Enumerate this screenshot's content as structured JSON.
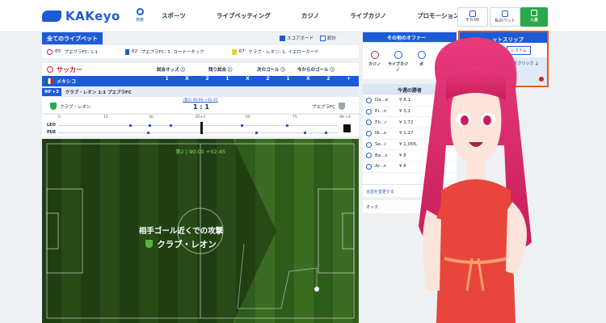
{
  "header": {
    "logo": "KAKeyo",
    "search_label": "検索",
    "nav": [
      "スポーツ",
      "ライブベッティング",
      "カジノ",
      "ライブカジノ",
      "プロモーション"
    ],
    "balance": "¥ 0.00",
    "mybets": "私のベット",
    "deposit": "入金"
  },
  "live": {
    "title": "全てのライブベット",
    "scoreboard_label": "スコアボード",
    "stats_label": "統計",
    "events": [
      {
        "min": "85'",
        "text": "プエブラFC: 1:1"
      },
      {
        "min": "82'",
        "text": "プエブラFC: 3. コーナーキック"
      },
      {
        "min": "67'",
        "text": "クラブ・レオン: 1. イエローカード"
      }
    ]
  },
  "sport": {
    "name": "サッカー",
    "markets": [
      "試合オッズ ⓘ",
      "残り試合 ⓘ",
      "次のゴール ⓘ",
      "今からのゴール ⓘ"
    ],
    "league": "メキシコ",
    "odd_cols": [
      "1",
      "X",
      "2",
      "1",
      "X",
      "2",
      "1",
      "X",
      "2",
      "+",
      "-"
    ],
    "match_minute": "90'+3",
    "match_line": "クラブ・レオン 1:1 プエブラFC"
  },
  "scoreboard": {
    "home": "クラブ・レオン",
    "away": "プエブラFC",
    "clock": "(第2) 90:00 +02:45",
    "score": "1 : 1"
  },
  "timeline": {
    "ticks": [
      "0",
      "15",
      "30",
      "45+1",
      "60",
      "75",
      "90 +3"
    ],
    "home_code": "LEO",
    "away_code": "PUE"
  },
  "pitch": {
    "clock": "第2 | 90:00 +02:45",
    "action": "相手ゴール近くでの攻撃",
    "team": "クラブ・レオン"
  },
  "offers": {
    "title": "その他のオファー",
    "tiles": [
      "カジノ",
      "ライブカジノ",
      "ポ",
      ""
    ]
  },
  "winners": {
    "title": "今週の勝者",
    "rows": [
      {
        "name": "Da...e",
        "amount": "¥ 8,1"
      },
      {
        "name": "Er...n",
        "amount": "¥ 3,1"
      },
      {
        "name": "Th...r",
        "amount": "¥ 1,72"
      },
      {
        "name": "Ni...o",
        "amount": "¥ 1,27"
      },
      {
        "name": "Se...l",
        "amount": "¥ 1,056,"
      },
      {
        "name": "Ba...s",
        "amount": "¥ 8"
      },
      {
        "name": "Ar...n",
        "amount": "¥ 8"
      }
    ],
    "change_lang": "言語を変更する",
    "odds_format": "オッズ"
  },
  "betslip": {
    "title": "ットスリップ",
    "tab": "システム",
    "info": "いません。 をクリック ょう!"
  },
  "colors": {
    "brand": "#1d5bd6",
    "accent_red": "#d21f2f",
    "deposit_green": "#2aa84a",
    "pitch_green": "#3a6d22"
  }
}
